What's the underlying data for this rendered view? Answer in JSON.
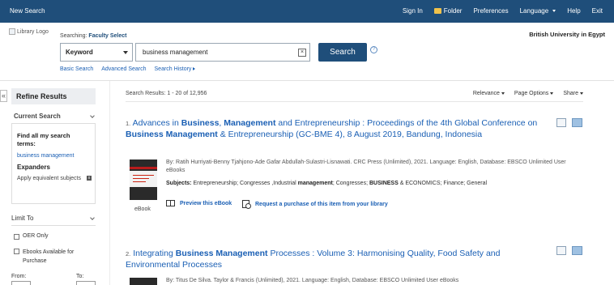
{
  "topbar": {
    "new_search": "New Search",
    "sign_in": "Sign In",
    "folder": "Folder",
    "preferences": "Preferences",
    "language": "Language",
    "help": "Help",
    "exit": "Exit"
  },
  "header": {
    "logo_alt": "Library Logo",
    "searching_label": "Searching:",
    "searching_value": "Faculty Select",
    "institution": "British University in Egypt",
    "field_select": "Keyword",
    "query": "business management",
    "search_button": "Search",
    "help_glyph": "?",
    "links": [
      "Basic Search",
      "Advanced Search",
      "Search History"
    ]
  },
  "left": {
    "collapse_glyph": "«",
    "refine_title": "Refine Results",
    "current_search_title": "Current Search",
    "find_all_label": "Find all my search terms:",
    "search_term": "business management",
    "expanders_label": "Expanders",
    "apply_equivalent": "Apply equivalent subjects",
    "remove_glyph": "x",
    "limit_to": "Limit To",
    "oer_only": "OER Only",
    "ebooks_purchase": "Ebooks Available for Purchase",
    "from_label": "From:",
    "to_label": "To:"
  },
  "results": {
    "count_text": "Search Results: 1 - 20 of 12,956",
    "relevance": "Relevance",
    "page_options": "Page Options",
    "share": "Share",
    "items": [
      {
        "number": "1.",
        "title_1": "Advances in ",
        "title_b1": "Business",
        "title_2": ", ",
        "title_b2": "Management",
        "title_3": " and Entrepreneurship : Proceedings of the 4th Global Conference on ",
        "title_b3": "Business Management",
        "title_4": " & Entrepreneurship (GC-BME 4), 8 August 2019, Bandung, Indonesia",
        "meta": "By: Ratih Hurriyati-Benny Tjahjono-Ade Gafar Abdullah-Sulastri-Lisnawati. CRC Press (Unlimited), 2021. Language: English, Database: EBSCO Unlimited User eBooks",
        "subjects_label": "Subjects:",
        "subjects_1": " Entrepreneurship; Congresses ,Industrial ",
        "subjects_b1": "management",
        "subjects_2": "; Congresses; ",
        "subjects_b2": "BUSINESS",
        "subjects_3": " & ECONOMICS; Finance; General",
        "format": "eBook",
        "preview": "Preview this eBook",
        "request": "Request a purchase of this item from your library"
      },
      {
        "number": "2.",
        "title_1": "Integrating ",
        "title_b1": "Business Management",
        "title_2": " Processes : Volume 3: Harmonising Quality, Food Safety and Environmental Processes",
        "meta": "By: Titus De Silva. Taylor & Francis (Unlimited), 2021. Language: English, Database: EBSCO Unlimited User eBooks"
      }
    ]
  },
  "colors": {
    "topbar": "#1f4e7a",
    "link": "#1a5fb4",
    "search_button": "#1f4e7a"
  }
}
